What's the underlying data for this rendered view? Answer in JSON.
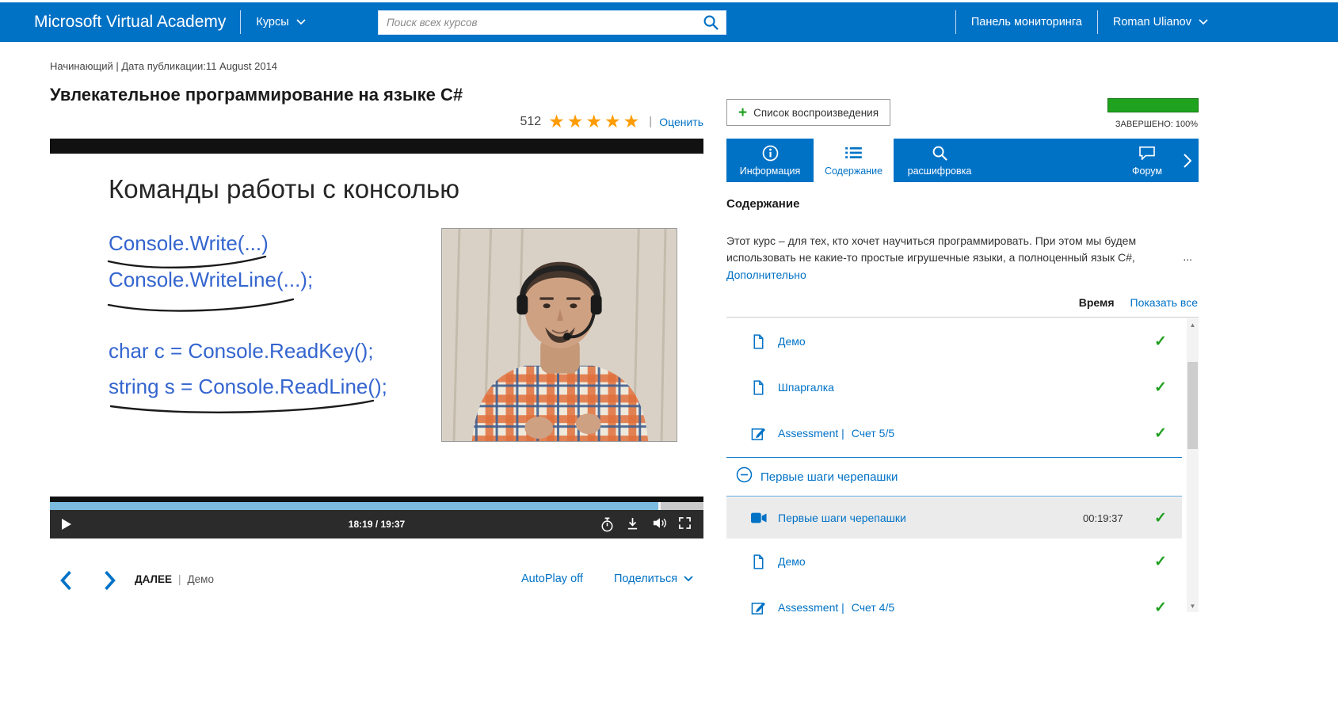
{
  "header": {
    "brand": "Microsoft Virtual Academy",
    "courses_menu": "Курсы",
    "search_placeholder": "Поиск всех курсов",
    "dashboard_link": "Панель мониторинга",
    "user_menu": "Roman Ulianov"
  },
  "course": {
    "meta": "Начинающий | Дата публикации:11 August 2014",
    "title": "Увлекательное программирование на языке C#",
    "rating_count": "512",
    "stars": "★★★★★",
    "rate_divider": "|",
    "rate_link": "Оценить"
  },
  "player": {
    "slide_title": "Команды работы с консолью",
    "code_lines": {
      "line1": "Console.Write(...)",
      "line2": "Console.WriteLine(...);",
      "line3": "char c = Console.ReadKey();",
      "line4": "string s = Console.ReadLine();"
    },
    "time_display": "18:19 / 19:37",
    "progress_percent": 93.4
  },
  "player_nav": {
    "next_label": "ДАЛЕЕ",
    "divider": "|",
    "next_item": "Демо",
    "autoplay_label": "AutoPlay off",
    "share_label": "Поделиться"
  },
  "sidebar": {
    "playlist_button": "Список воспроизведения",
    "completed_label": "ЗАВЕРШЕНО: 100%",
    "tabs": {
      "info": "Информация",
      "contents": "Содержание",
      "transcript": "расшифровка",
      "forum": "Форум"
    },
    "heading": "Содержание",
    "description": "Этот курс – для тех, кто хочет научиться программировать. При этом мы будем использовать не какие-то простые игрушечные языки, а полноценный язык C#,",
    "ellipsis": "...",
    "more_link": "Дополнительно",
    "time_header": "Время",
    "show_all_link": "Показать все",
    "group_header": "Первые шаги черепашки",
    "items": [
      {
        "label": "Демо"
      },
      {
        "label": "Шпаргалка"
      },
      {
        "label": "Assessment |",
        "score": "Счет 5/5"
      },
      {
        "label": "Первые шаги черепашки",
        "time": "00:19:37"
      },
      {
        "label": "Демо"
      },
      {
        "label": "Assessment |",
        "score": "Счет 4/5"
      }
    ]
  }
}
